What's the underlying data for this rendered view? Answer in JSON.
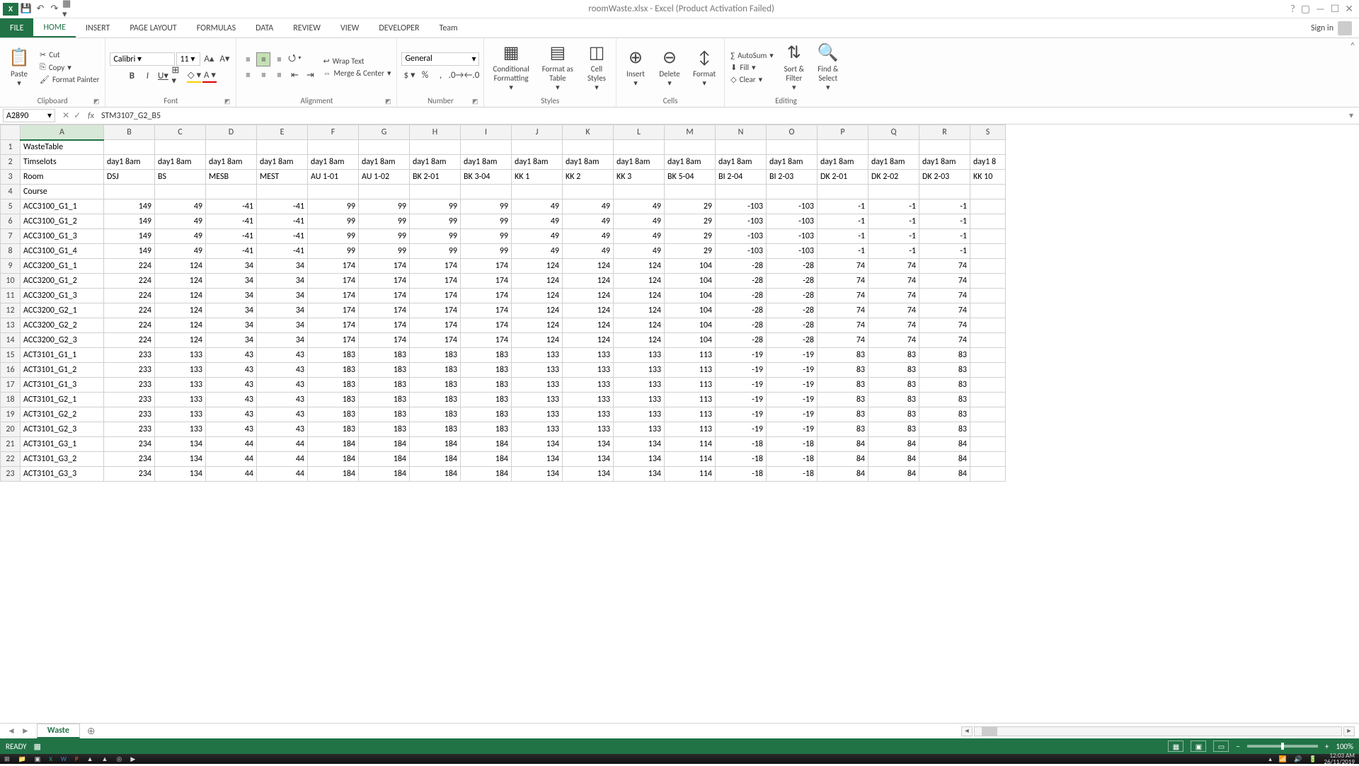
{
  "title": "roomWaste.xlsx - Excel (Product Activation Failed)",
  "qat": {
    "undo": "↶",
    "redo": "↷"
  },
  "tabs": {
    "file": "FILE",
    "home": "HOME",
    "insert": "INSERT",
    "pagelayout": "PAGE LAYOUT",
    "formulas": "FORMULAS",
    "data": "DATA",
    "review": "REVIEW",
    "view": "VIEW",
    "developer": "DEVELOPER",
    "team": "Team",
    "signin": "Sign in"
  },
  "ribbon": {
    "clipboard": {
      "paste": "Paste",
      "cut": "Cut",
      "copy": "Copy",
      "fp": "Format Painter",
      "label": "Clipboard"
    },
    "font": {
      "name": "Calibri",
      "size": "11",
      "bold": "B",
      "italic": "I",
      "underline": "U",
      "label": "Font"
    },
    "align": {
      "wrap": "Wrap Text",
      "merge": "Merge & Center",
      "label": "Alignment"
    },
    "number": {
      "fmt": "General",
      "label": "Number"
    },
    "styles": {
      "cf": "Conditional",
      "cf2": "Formatting",
      "fat": "Format as",
      "fat2": "Table",
      "cs": "Cell",
      "cs2": "Styles",
      "label": "Styles"
    },
    "cells": {
      "ins": "Insert",
      "del": "Delete",
      "fmt": "Format",
      "label": "Cells"
    },
    "editing": {
      "sum": "AutoSum",
      "fill": "Fill",
      "clear": "Clear",
      "sort": "Sort &",
      "sort2": "Filter",
      "find": "Find &",
      "find2": "Select",
      "label": "Editing"
    }
  },
  "namebox": "A2890",
  "formula": "STM3107_G2_B5",
  "cols": [
    "A",
    "B",
    "C",
    "D",
    "E",
    "F",
    "G",
    "H",
    "I",
    "J",
    "K",
    "L",
    "M",
    "N",
    "O",
    "P",
    "Q",
    "R",
    "S"
  ],
  "rowheads": [
    "1",
    "2",
    "3",
    "4",
    "5",
    "6",
    "7",
    "8",
    "9",
    "10",
    "11",
    "12",
    "13",
    "14",
    "15",
    "16",
    "17",
    "18",
    "19",
    "20",
    "21",
    "22",
    "23"
  ],
  "row1": [
    "WasteTable",
    "",
    "",
    "",
    "",
    "",
    "",
    "",
    "",
    "",
    "",
    "",
    "",
    "",
    "",
    "",
    "",
    "",
    ""
  ],
  "row2": [
    "Timselots",
    "day1 8am",
    "day1 8am",
    "day1 8am",
    "day1 8am",
    "day1 8am",
    "day1 8am",
    "day1 8am",
    "day1 8am",
    "day1 8am",
    "day1 8am",
    "day1 8am",
    "day1 8am",
    "day1 8am",
    "day1 8am",
    "day1 8am",
    "day1 8am",
    "day1 8am",
    "day1 8"
  ],
  "row3": [
    "Room",
    "DSJ",
    "BS",
    "MESB",
    "MEST",
    "AU 1-01",
    "AU 1-02",
    "BK 2-01",
    "BK 3-04",
    "KK 1",
    "KK 2",
    "KK 3",
    "BK 5-04",
    "BI 2-04",
    "BI 2-03",
    "DK 2-01",
    "DK 2-02",
    "DK 2-03",
    "KK 10"
  ],
  "row4": [
    "Course",
    "",
    "",
    "",
    "",
    "",
    "",
    "",
    "",
    "",
    "",
    "",
    "",
    "",
    "",
    "",
    "",
    "",
    ""
  ],
  "dataRows": [
    {
      "label": "ACC3100_G1_1",
      "v": [
        149,
        49,
        -41,
        -41,
        99,
        99,
        99,
        99,
        49,
        49,
        49,
        29,
        -103,
        -103,
        -1,
        -1,
        -1
      ]
    },
    {
      "label": "ACC3100_G1_2",
      "v": [
        149,
        49,
        -41,
        -41,
        99,
        99,
        99,
        99,
        49,
        49,
        49,
        29,
        -103,
        -103,
        -1,
        -1,
        -1
      ]
    },
    {
      "label": "ACC3100_G1_3",
      "v": [
        149,
        49,
        -41,
        -41,
        99,
        99,
        99,
        99,
        49,
        49,
        49,
        29,
        -103,
        -103,
        -1,
        -1,
        -1
      ]
    },
    {
      "label": "ACC3100_G1_4",
      "v": [
        149,
        49,
        -41,
        -41,
        99,
        99,
        99,
        99,
        49,
        49,
        49,
        29,
        -103,
        -103,
        -1,
        -1,
        -1
      ]
    },
    {
      "label": "ACC3200_G1_1",
      "v": [
        224,
        124,
        34,
        34,
        174,
        174,
        174,
        174,
        124,
        124,
        124,
        104,
        -28,
        -28,
        74,
        74,
        74
      ]
    },
    {
      "label": "ACC3200_G1_2",
      "v": [
        224,
        124,
        34,
        34,
        174,
        174,
        174,
        174,
        124,
        124,
        124,
        104,
        -28,
        -28,
        74,
        74,
        74
      ]
    },
    {
      "label": "ACC3200_G1_3",
      "v": [
        224,
        124,
        34,
        34,
        174,
        174,
        174,
        174,
        124,
        124,
        124,
        104,
        -28,
        -28,
        74,
        74,
        74
      ]
    },
    {
      "label": "ACC3200_G2_1",
      "v": [
        224,
        124,
        34,
        34,
        174,
        174,
        174,
        174,
        124,
        124,
        124,
        104,
        -28,
        -28,
        74,
        74,
        74
      ]
    },
    {
      "label": "ACC3200_G2_2",
      "v": [
        224,
        124,
        34,
        34,
        174,
        174,
        174,
        174,
        124,
        124,
        124,
        104,
        -28,
        -28,
        74,
        74,
        74
      ]
    },
    {
      "label": "ACC3200_G2_3",
      "v": [
        224,
        124,
        34,
        34,
        174,
        174,
        174,
        174,
        124,
        124,
        124,
        104,
        -28,
        -28,
        74,
        74,
        74
      ]
    },
    {
      "label": "ACT3101_G1_1",
      "v": [
        233,
        133,
        43,
        43,
        183,
        183,
        183,
        183,
        133,
        133,
        133,
        113,
        -19,
        -19,
        83,
        83,
        83
      ]
    },
    {
      "label": "ACT3101_G1_2",
      "v": [
        233,
        133,
        43,
        43,
        183,
        183,
        183,
        183,
        133,
        133,
        133,
        113,
        -19,
        -19,
        83,
        83,
        83
      ]
    },
    {
      "label": "ACT3101_G1_3",
      "v": [
        233,
        133,
        43,
        43,
        183,
        183,
        183,
        183,
        133,
        133,
        133,
        113,
        -19,
        -19,
        83,
        83,
        83
      ]
    },
    {
      "label": "ACT3101_G2_1",
      "v": [
        233,
        133,
        43,
        43,
        183,
        183,
        183,
        183,
        133,
        133,
        133,
        113,
        -19,
        -19,
        83,
        83,
        83
      ]
    },
    {
      "label": "ACT3101_G2_2",
      "v": [
        233,
        133,
        43,
        43,
        183,
        183,
        183,
        183,
        133,
        133,
        133,
        113,
        -19,
        -19,
        83,
        83,
        83
      ]
    },
    {
      "label": "ACT3101_G2_3",
      "v": [
        233,
        133,
        43,
        43,
        183,
        183,
        183,
        183,
        133,
        133,
        133,
        113,
        -19,
        -19,
        83,
        83,
        83
      ]
    },
    {
      "label": "ACT3101_G3_1",
      "v": [
        234,
        134,
        44,
        44,
        184,
        184,
        184,
        184,
        134,
        134,
        134,
        114,
        -18,
        -18,
        84,
        84,
        84
      ]
    },
    {
      "label": "ACT3101_G3_2",
      "v": [
        234,
        134,
        44,
        44,
        184,
        184,
        184,
        184,
        134,
        134,
        134,
        114,
        -18,
        -18,
        84,
        84,
        84
      ]
    },
    {
      "label": "ACT3101_G3_3",
      "v": [
        234,
        134,
        44,
        44,
        184,
        184,
        184,
        184,
        134,
        134,
        134,
        114,
        -18,
        -18,
        84,
        84,
        84
      ]
    }
  ],
  "sheet": {
    "name": "Waste"
  },
  "status": {
    "ready": "READY",
    "zoom": "100%"
  },
  "clock": {
    "time": "12:03 AM",
    "date": "26/11/2019"
  }
}
